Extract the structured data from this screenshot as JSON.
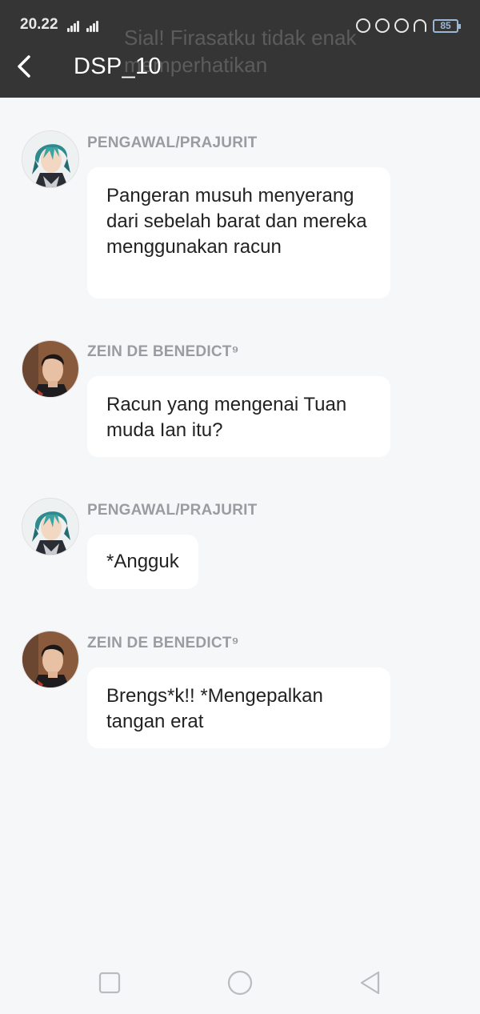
{
  "status_bar": {
    "time": "20.22",
    "battery": "85"
  },
  "header": {
    "title": "DSP_10",
    "ghost_text": "Sial! Firasatku tidak enak memperhatikan"
  },
  "messages": [
    {
      "sender": "PENGAWAL/PRAJURIT",
      "avatar": "teal-hair-soldier-avatar",
      "text": "Pangeran musuh menyerang dari sebelah barat dan mereka menggunakan racun"
    },
    {
      "sender": "ZEIN DE BENEDICT⁹",
      "avatar": "dark-hair-man-avatar",
      "text": "Racun yang mengenai Tuan muda Ian itu?"
    },
    {
      "sender": "PENGAWAL/PRAJURIT",
      "avatar": "teal-hair-soldier-avatar",
      "text": "*Angguk"
    },
    {
      "sender": "ZEIN DE BENEDICT⁹",
      "avatar": "dark-hair-man-avatar",
      "text": "Brengs*k!! *Mengepalkan tangan erat"
    }
  ],
  "colors": {
    "header_bg": "#353535",
    "page_bg": "#f6f7f9",
    "bubble_bg": "#ffffff",
    "sender_text": "#9a9ca1"
  }
}
